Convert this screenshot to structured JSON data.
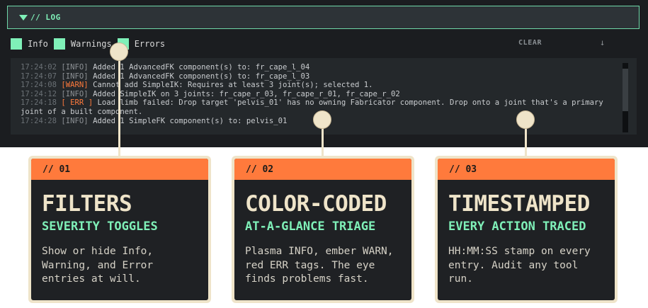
{
  "log": {
    "header_title": "// LOG",
    "filters": [
      {
        "label": "Info",
        "checked": true
      },
      {
        "label": "Warnings",
        "checked": true
      },
      {
        "label": "Errors",
        "checked": true
      }
    ],
    "clear_label": "CLEAR",
    "scroll_icon": "↓",
    "entries": [
      {
        "time": "17:24:02",
        "tag": "[INFO]",
        "level": "info",
        "message": " Added 1 AdvancedFK component(s) to: fr_cape_l_04"
      },
      {
        "time": "17:24:07",
        "tag": "[INFO]",
        "level": "info",
        "message": " Added 1 AdvancedFK component(s) to: fr_cape_l_03"
      },
      {
        "time": "17:24:08",
        "tag": "[WARN]",
        "level": "warn",
        "message": " Cannot add SimpleIK: Requires at least 3 joint(s); selected 1."
      },
      {
        "time": "17:24:12",
        "tag": "[INFO]",
        "level": "info",
        "message": " Added SimpleIK on 3 joints: fr_cape_r_03, fr_cape_r_01, fr_cape_r_02"
      },
      {
        "time": "17:24:18",
        "tag": "[ ERR ]",
        "level": "err",
        "message": " Load limb failed: Drop target 'pelvis_01' has no owning Fabricator component. Drop onto a joint that's a primary joint of a built component."
      },
      {
        "time": "17:24:28",
        "tag": "[INFO]",
        "level": "info",
        "message": " Added 1 SimpleFK component(s) to: pelvis_01"
      }
    ]
  },
  "cards": [
    {
      "num": "// 01",
      "title": "FILTERS",
      "subtitle": "SEVERITY TOGGLES",
      "body": "Show or hide Info, Warning, and Error entries at will."
    },
    {
      "num": "// 02",
      "title": "COLOR-CODED",
      "subtitle": "AT-A-GLANCE TRIAGE",
      "body": "Plasma INFO, ember WARN, red ERR tags. The eye finds problems fast."
    },
    {
      "num": "// 03",
      "title": "TIMESTAMPED",
      "subtitle": "EVERY ACTION TRACED",
      "body": "HH:MM:SS stamp on every entry. Audit any tool run."
    }
  ],
  "colors": {
    "accent_green": "#7ff0b8",
    "accent_orange": "#ff7a3c",
    "cream": "#efe4c9",
    "panel_bg": "#1b1d20"
  }
}
